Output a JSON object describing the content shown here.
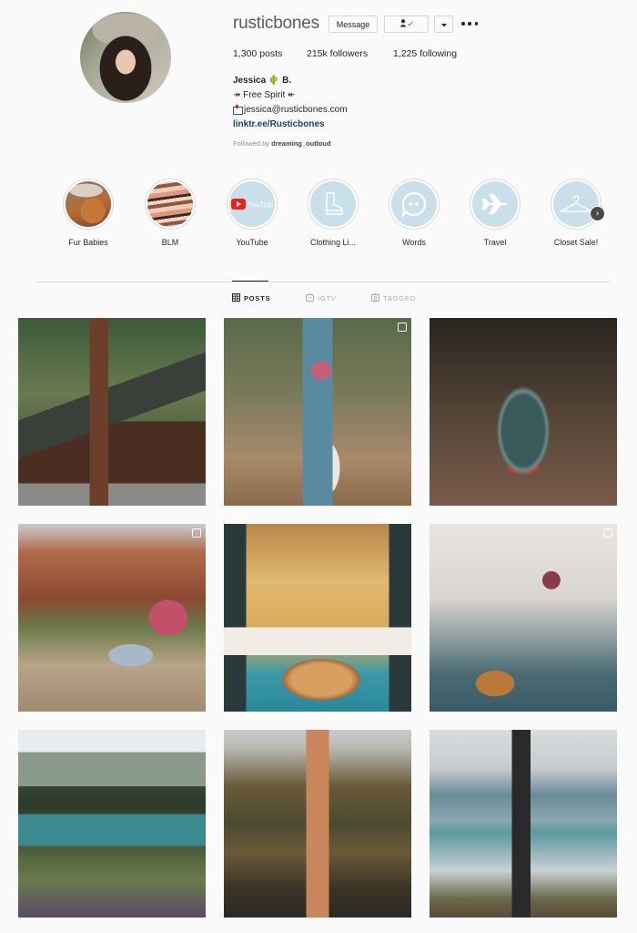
{
  "profile": {
    "username": "rusticbones",
    "avatar_alt": "profile-photo",
    "buttons": {
      "message": "Message",
      "follow_icon": "person-check-icon",
      "dropdown_icon": "caret-down-icon",
      "more_icon": "ellipsis-icon"
    },
    "stats": {
      "posts": "1,300 posts",
      "followers": "215k followers",
      "following": "1,225 following"
    },
    "bio": {
      "name": "Jessica 🌵 B.",
      "tagline": "↠ Free Spirit ↞",
      "email": "jessica@rusticbones.com",
      "link": "linktr.ee/Rusticbones"
    },
    "followed_by_prefix": "Followed by",
    "followed_by_user": "dreaming_outloud"
  },
  "highlights": [
    {
      "label": "Fur Babies",
      "icon": "cat-photo"
    },
    {
      "label": "BLM",
      "icon": "hands-photo"
    },
    {
      "label": "YouTube",
      "icon": "youtube-logo"
    },
    {
      "label": "Clothing Li...",
      "icon": "boot-icon"
    },
    {
      "label": "Words",
      "icon": "quote-bubble-icon"
    },
    {
      "label": "Travel",
      "icon": "airplane-icon"
    },
    {
      "label": "Closet Sale!",
      "icon": "hanger-icon"
    }
  ],
  "highlights_next_icon": "chevron-right-icon",
  "tabs": [
    {
      "label": "POSTS",
      "icon": "grid-icon",
      "active": true
    },
    {
      "label": "IGTV",
      "icon": "tv-icon",
      "active": false
    },
    {
      "label": "TAGGED",
      "icon": "tag-icon",
      "active": false
    }
  ],
  "posts": [
    {
      "subject": "a-frame cabin in redwood forest",
      "multiple": false
    },
    {
      "subject": "woman with pink hair and backpack on forest trail",
      "multiple": true
    },
    {
      "subject": "mason jar with tiny hammock scene",
      "multiple": false
    },
    {
      "subject": "woman with pink hair sitting on dirt path near red rocks",
      "multiple": true
    },
    {
      "subject": "pizza in van with socked feet and autumn trees",
      "multiple": false
    },
    {
      "subject": "woman lying on bed with cat",
      "multiple": true
    },
    {
      "subject": "turquoise mountain lake with pine trees",
      "multiple": false
    },
    {
      "subject": "woman standing before mountain lake reflection",
      "multiple": false
    },
    {
      "subject": "person on stump at glacial lake",
      "multiple": false
    }
  ]
}
